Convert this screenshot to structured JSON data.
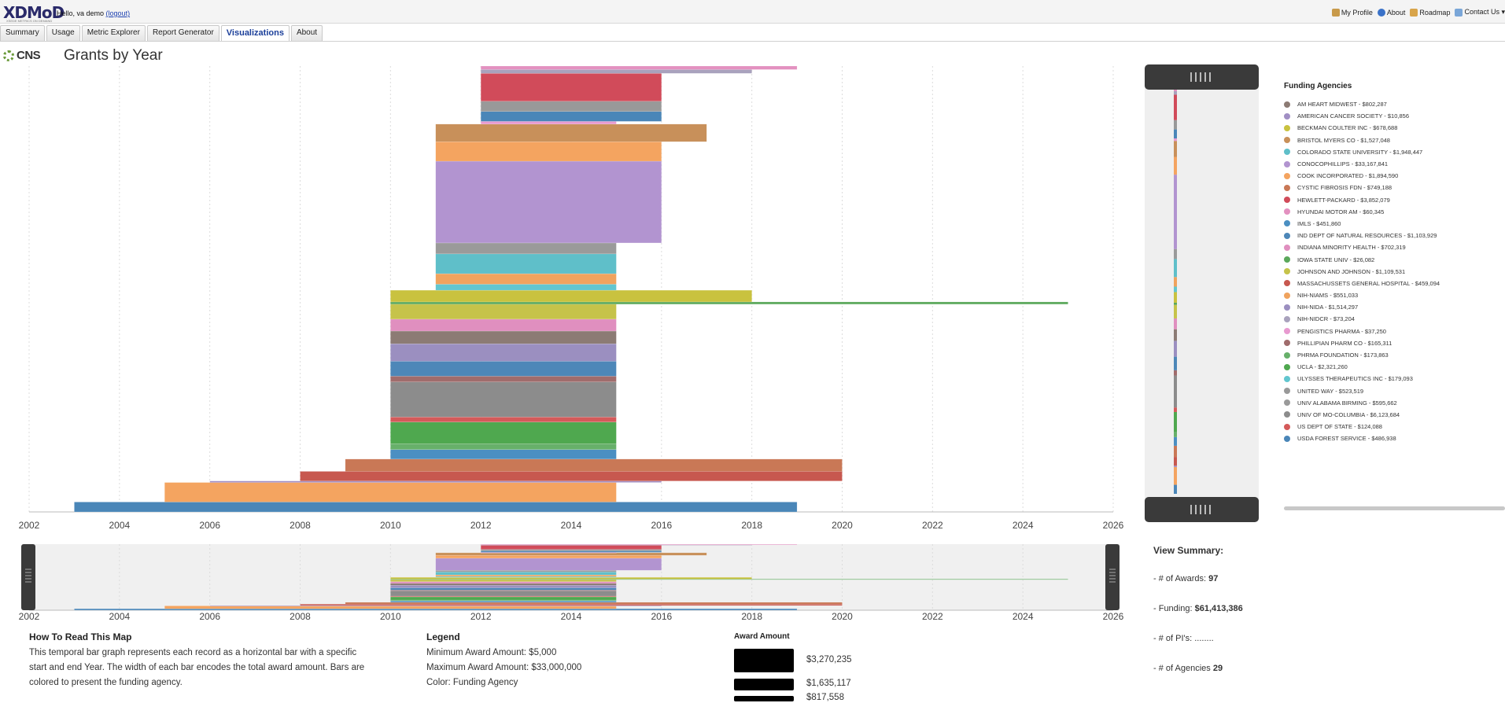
{
  "header": {
    "logo_text": "XDMoD",
    "logo_sub": "XSEDE METRICS ON DEMAND",
    "greeting": "Hello, va demo",
    "logout": "(logout)",
    "links": [
      {
        "label": "My Profile",
        "icon": "user-icon",
        "color": "#c89a4a"
      },
      {
        "label": "About",
        "icon": "info-icon",
        "color": "#3a72c8"
      },
      {
        "label": "Roadmap",
        "icon": "roadmap-icon",
        "color": "#d8a44a"
      },
      {
        "label": "Contact Us ▾",
        "icon": "contact-icon",
        "color": "#7aa6d8"
      }
    ]
  },
  "tabs": [
    {
      "label": "Summary",
      "active": false
    },
    {
      "label": "Usage",
      "active": false
    },
    {
      "label": "Metric Explorer",
      "active": false
    },
    {
      "label": "Report Generator",
      "active": false
    },
    {
      "label": "Visualizations",
      "active": true
    },
    {
      "label": "About",
      "active": false
    }
  ],
  "brand": "CNS",
  "page_title": "Grants by Year",
  "chart_data": {
    "type": "temporal-bar",
    "x_ticks": [
      "2002",
      "2004",
      "2006",
      "2008",
      "2010",
      "2012",
      "2014",
      "2016",
      "2018",
      "2020",
      "2022",
      "2024",
      "2026"
    ],
    "xlim": [
      2002,
      2026
    ],
    "grid": true,
    "bars": [
      {
        "start": 2012,
        "end": 2019,
        "amount": 60345,
        "agency": "HYUNDAI MOTOR AM"
      },
      {
        "start": 2012,
        "end": 2018,
        "amount": 73204,
        "agency": "NIH-NIDCR"
      },
      {
        "start": 2012,
        "end": 2016,
        "amount": 3852079,
        "agency": "HEWLETT-PACKARD"
      },
      {
        "start": 2012,
        "end": 2016,
        "amount": 523519,
        "agency": "UNITED WAY"
      },
      {
        "start": 2012,
        "end": 2016,
        "amount": 486938,
        "agency": "USDA FOREST SERVICE"
      },
      {
        "start": 2012,
        "end": 2015,
        "amount": 37250,
        "agency": "PENGISTICS PHARMA"
      },
      {
        "start": 2011,
        "end": 2017,
        "amount": 1527048,
        "agency": "BRISTOL MYERS CO"
      },
      {
        "start": 2011,
        "end": 2016,
        "amount": 1894590,
        "agency": "COOK INCORPORATED"
      },
      {
        "start": 2011,
        "end": 2016,
        "amount": 33167841,
        "agency": "CONOCOPHILLIPS"
      },
      {
        "start": 2011,
        "end": 2015,
        "amount": 595662,
        "agency": "UNIV ALABAMA BIRMING"
      },
      {
        "start": 2011,
        "end": 2015,
        "amount": 1948447,
        "agency": "COLORADO STATE UNIVERSITY"
      },
      {
        "start": 2011,
        "end": 2015,
        "amount": 551033,
        "agency": "NIH-NIAMS"
      },
      {
        "start": 2011,
        "end": 2015,
        "amount": 179093,
        "agency": "ULYSSES THERAPEUTICS INC"
      },
      {
        "start": 2010,
        "end": 2018,
        "amount": 678688,
        "agency": "BECKMAN COULTER INC"
      },
      {
        "start": 2010,
        "end": 2025,
        "amount": 26082,
        "agency": "IOWA STATE UNIV"
      },
      {
        "start": 2010,
        "end": 2015,
        "amount": 1109531,
        "agency": "JOHNSON AND JOHNSON"
      },
      {
        "start": 2010,
        "end": 2015,
        "amount": 702319,
        "agency": "INDIANA MINORITY HEALTH"
      },
      {
        "start": 2010,
        "end": 2015,
        "amount": 802287,
        "agency": "AM HEART MIDWEST"
      },
      {
        "start": 2010,
        "end": 2015,
        "amount": 1514297,
        "agency": "NIH-NIDA"
      },
      {
        "start": 2010,
        "end": 2015,
        "amount": 1103929,
        "agency": "IND DEPT OF NATURAL RESOURCES"
      },
      {
        "start": 2010,
        "end": 2015,
        "amount": 165311,
        "agency": "PHILLIPIAN PHARM CO"
      },
      {
        "start": 2010,
        "end": 2015,
        "amount": 6123684,
        "agency": "UNIV OF MO-COLUMBIA"
      },
      {
        "start": 2010,
        "end": 2015,
        "amount": 124088,
        "agency": "US DEPT OF STATE"
      },
      {
        "start": 2010,
        "end": 2015,
        "amount": 2321260,
        "agency": "UCLA"
      },
      {
        "start": 2010,
        "end": 2015,
        "amount": 173863,
        "agency": "PHRMA FOUNDATION"
      },
      {
        "start": 2010,
        "end": 2015,
        "amount": 451860,
        "agency": "IMLS"
      },
      {
        "start": 2009,
        "end": 2020,
        "amount": 749188,
        "agency": "CYSTIC FIBROSIS FDN"
      },
      {
        "start": 2008,
        "end": 2020,
        "amount": 459094,
        "agency": "MASSACHUSSETS GENERAL HOSPITAL"
      },
      {
        "start": 2006,
        "end": 2016,
        "amount": 10856,
        "agency": "AMERICAN CANCER SOCIETY"
      },
      {
        "start": 2005,
        "end": 2015,
        "amount": 1894590,
        "agency": "COOK INCORPORATED"
      },
      {
        "start": 2003,
        "end": 2019,
        "amount": 486938,
        "agency": "USDA FOREST SERVICE"
      }
    ]
  },
  "legend": {
    "title": "Funding Agencies",
    "items": [
      {
        "label": "AM HEART MIDWEST - $802,287",
        "color": "#8c7b74"
      },
      {
        "label": "AMERICAN CANCER SOCIETY - $10,856",
        "color": "#a18fc4"
      },
      {
        "label": "BECKMAN COULTER INC - $678,688",
        "color": "#c9c23f"
      },
      {
        "label": "BRISTOL MYERS CO - $1,527,048",
        "color": "#c8905a"
      },
      {
        "label": "COLORADO STATE UNIVERSITY - $1,948,447",
        "color": "#5fbfc9"
      },
      {
        "label": "CONOCOPHILLIPS - $33,167,841",
        "color": "#b294d0"
      },
      {
        "label": "COOK INCORPORATED - $1,894,590",
        "color": "#f4a460"
      },
      {
        "label": "CYSTIC FIBROSIS FDN - $749,188",
        "color": "#c97856"
      },
      {
        "label": "HEWLETT-PACKARD - $3,852,079",
        "color": "#d14b5a"
      },
      {
        "label": "HYUNDAI MOTOR AM - $60,345",
        "color": "#e391c0"
      },
      {
        "label": "IMLS - $451,860",
        "color": "#4b8fc2"
      },
      {
        "label": "IND DEPT OF NATURAL RESOURCES - $1,103,929",
        "color": "#4d87b8"
      },
      {
        "label": "INDIANA MINORITY HEALTH - $702,319",
        "color": "#e08fbf"
      },
      {
        "label": "IOWA STATE UNIV - $26,082",
        "color": "#5ba85b"
      },
      {
        "label": "JOHNSON AND JOHNSON - $1,109,531",
        "color": "#c6c34a"
      },
      {
        "label": "MASSACHUSSETS GENERAL HOSPITAL - $459,094",
        "color": "#c7584f"
      },
      {
        "label": "NIH-NIAMS - $551,033",
        "color": "#f0a35e"
      },
      {
        "label": "NIH-NIDA - $1,514,297",
        "color": "#9b8fc0"
      },
      {
        "label": "NIH-NIDCR - $73,204",
        "color": "#a9a2bd"
      },
      {
        "label": "PENGISTICS PHARMA - $37,250",
        "color": "#e89ad0"
      },
      {
        "label": "PHILLIPIAN PHARM CO - $165,311",
        "color": "#a06c6c"
      },
      {
        "label": "PHRMA FOUNDATION - $173,863",
        "color": "#67b06a"
      },
      {
        "label": "UCLA - $2,321,260",
        "color": "#4fa84f"
      },
      {
        "label": "ULYSSES THERAPEUTICS INC - $179,093",
        "color": "#62c6cf"
      },
      {
        "label": "UNITED WAY - $523,519",
        "color": "#999999"
      },
      {
        "label": "UNIV ALABAMA BIRMING - $595,662",
        "color": "#9a9a9a"
      },
      {
        "label": "UNIV OF MO-COLUMBIA - $6,123,684",
        "color": "#8c8c8c"
      },
      {
        "label": "US DEPT OF STATE - $124,088",
        "color": "#d45a5a"
      },
      {
        "label": "USDA FOREST SERVICE - $486,938",
        "color": "#4a86b8"
      }
    ]
  },
  "view_summary": {
    "title": "View Summary:",
    "awards_label": "- # of Awards:",
    "awards_value": "97",
    "funding_label": "- Funding:",
    "funding_value": "$61,413,386",
    "pis_label": "- # of PI's: ........",
    "agencies_label": "- # of Agencies",
    "agencies_value": "29"
  },
  "how_to": {
    "title": "How To Read This Map",
    "lines": [
      "This temporal bar graph represents each record as a horizontal bar with a specific",
      "start and end Year. The width of each bar encodes the total award amount. Bars are",
      "colored to present the funding agency."
    ]
  },
  "legend_info": {
    "title": "Legend",
    "lines": [
      "Minimum Award Amount: $5,000",
      "Maximum Award Amount: $33,000,000",
      "Color: Funding Agency"
    ]
  },
  "award_amount": {
    "title": "Award Amount",
    "items": [
      {
        "label": "$3,270,235",
        "amount": 3270235
      },
      {
        "label": "$1,635,117",
        "amount": 1635117
      },
      {
        "label": "$817,558",
        "amount": 817558
      }
    ]
  }
}
